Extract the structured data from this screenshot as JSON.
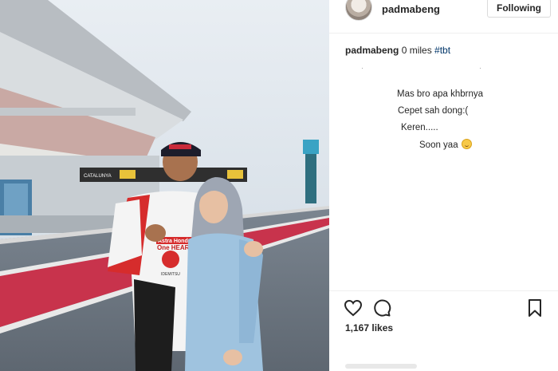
{
  "post": {
    "username": "padmabeng",
    "follow_label": "Following",
    "caption": {
      "username": "padmabeng",
      "text": "0 miles",
      "hashtag": "#tbt"
    },
    "comments": [
      "Mas bro apa khbrnya",
      "Cepet sah dong:(",
      "Keren.....",
      "Soon yaa"
    ],
    "likes": "1,167 likes"
  },
  "photo": {
    "banner_text": "CATALUNYA",
    "jacket_text": "One HEART.",
    "brand_text": "Astra Honda",
    "sponsor_text": "IDEMITSU"
  },
  "icons": {
    "like": "heart-icon",
    "comment": "comment-bubble-icon",
    "save": "bookmark-icon"
  },
  "colors": {
    "hashtag": "#003569",
    "track_red": "#c8334c",
    "jacket_red": "#d62c2c"
  }
}
